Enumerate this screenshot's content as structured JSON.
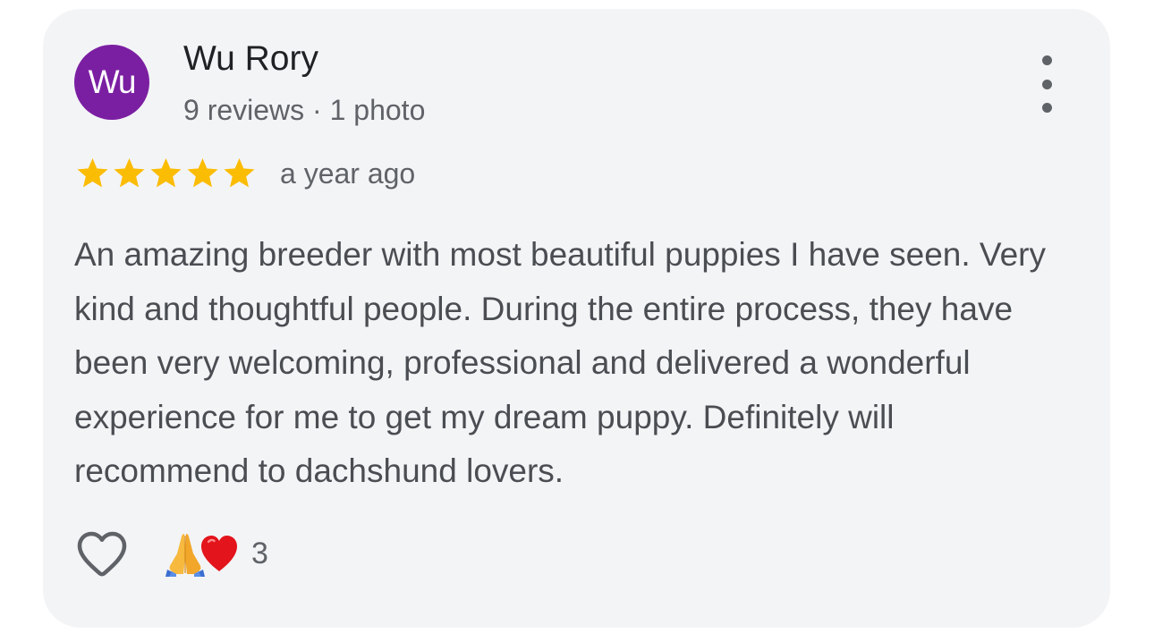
{
  "author": {
    "avatar_initials": "Wu",
    "avatar_color": "#7b1fa2",
    "name": "Wu Rory",
    "meta": "9 reviews · 1 photo"
  },
  "review": {
    "rating": 5,
    "max_rating": 5,
    "star_color": "#fbbc04",
    "date": "a year ago",
    "text": "An amazing breeder with most beautiful puppies I have seen. Very kind and thoughtful people. During the entire process, they have been very welcoming, professional and delivered a wonderful experience for me to get my dream puppy. Definitely will recommend to dachshund lovers."
  },
  "actions": {
    "more_icon": "more-vert-icon",
    "like_icon": "heart-outline-icon",
    "reaction_icons": [
      "folded-hands-emoji",
      "red-heart-emoji"
    ],
    "reaction_count": "3"
  }
}
